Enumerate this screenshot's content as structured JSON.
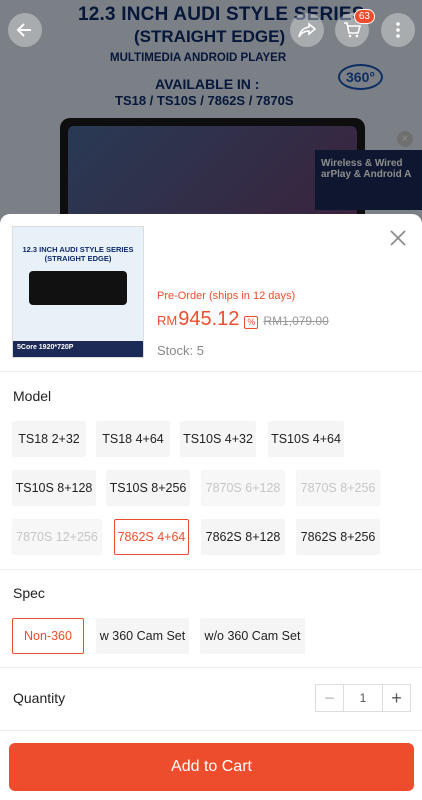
{
  "banner": {
    "title": "12.3 INCH AUDI STYLE SERIES",
    "subtitle": "(STRAIGHT EDGE)",
    "multimedia": "MULTIMEDIA ANDROID PLAYER",
    "available_label": "AVAILABLE IN :",
    "models": "TS18 / TS10S / 7862S / 7870S",
    "badge_360": "360°",
    "wireless_text": "Wireless & Wired arPlay & Android A",
    "cart_count": "63"
  },
  "product": {
    "thumb_title": "12.3 INCH AUDI STYLE SERIES (STRAIGHT EDGE)",
    "thumb_footer": "5Core 1920*720P",
    "preorder_text": "Pre-Order (ships in 12 days)",
    "currency": "RM",
    "price": "945.12",
    "discount_icon": "%",
    "old_price": "RM1,079.00",
    "stock": "Stock: 5"
  },
  "model": {
    "label": "Model",
    "options": [
      {
        "label": "TS18 2+32",
        "state": "normal"
      },
      {
        "label": "TS18 4+64",
        "state": "normal"
      },
      {
        "label": "TS10S 4+32",
        "state": "normal"
      },
      {
        "label": "TS10S 4+64",
        "state": "normal"
      },
      {
        "label": "TS10S 8+128",
        "state": "normal"
      },
      {
        "label": "TS10S 8+256",
        "state": "normal"
      },
      {
        "label": "7870S 6+128",
        "state": "disabled"
      },
      {
        "label": "7870S 8+256",
        "state": "disabled"
      },
      {
        "label": "7870S 12+256",
        "state": "disabled"
      },
      {
        "label": "7862S 4+64",
        "state": "selected"
      },
      {
        "label": "7862S 8+128",
        "state": "normal"
      },
      {
        "label": "7862S 8+256",
        "state": "normal"
      }
    ]
  },
  "spec": {
    "label": "Spec",
    "options": [
      {
        "label": "Non-360",
        "state": "selected"
      },
      {
        "label": "w 360 Cam Set",
        "state": "normal"
      },
      {
        "label": "w/o 360 Cam Set",
        "state": "normal"
      }
    ]
  },
  "quantity": {
    "label": "Quantity",
    "minus": "−",
    "value": "1",
    "plus": "+"
  },
  "add_to_cart": "Add to Cart",
  "colors": {
    "accent": "#ee4d2d",
    "option_bg": "#f5f5f5",
    "disabled_text": "#c6c6c6"
  }
}
